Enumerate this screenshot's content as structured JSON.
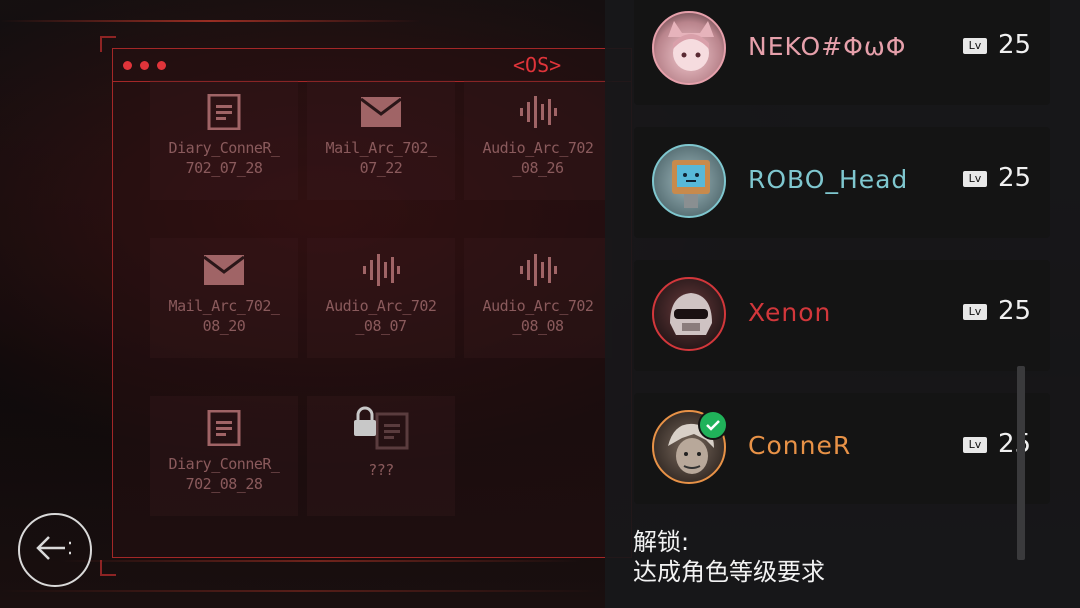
{
  "os_window": {
    "label": "<OS>"
  },
  "files": [
    {
      "icon": "document-icon",
      "label": "Diary_ConneR_\n702_07_28"
    },
    {
      "icon": "mail-icon",
      "label": "Mail_Arc_702_\n07_22"
    },
    {
      "icon": "audio-wave-icon",
      "label": "Audio_Arc_702\n_08_26"
    },
    {
      "icon": "mail-icon",
      "label": "Mail_Arc_702_\n08_20"
    },
    {
      "icon": "audio-wave-icon",
      "label": "Audio_Arc_702\n_08_07"
    },
    {
      "icon": "audio-wave-icon",
      "label": "Audio_Arc_702\n_08_08"
    },
    {
      "icon": "document-icon",
      "label": "Diary_ConneR_\n702_08_28"
    },
    {
      "icon": "locked-document-icon",
      "label": "???"
    }
  ],
  "players": [
    {
      "name": "NEKO#ΦωΦ",
      "level_badge": "Lv",
      "level": "25",
      "color": "#e6a0ab"
    },
    {
      "name": "ROBO_Head",
      "level_badge": "Lv",
      "level": "25",
      "color": "#7fc7cf"
    },
    {
      "name": "Xenon",
      "level_badge": "Lv",
      "level": "25",
      "color": "#d2373b"
    },
    {
      "name": "ConneR",
      "level_badge": "Lv",
      "level": "25",
      "color": "#e89247",
      "selected": true
    }
  ],
  "unlock": {
    "title": "解锁:",
    "requirement": "达成角色等级要求"
  },
  "icons": {
    "back": "back-arrow-icon",
    "selected": "checkmark-icon"
  }
}
